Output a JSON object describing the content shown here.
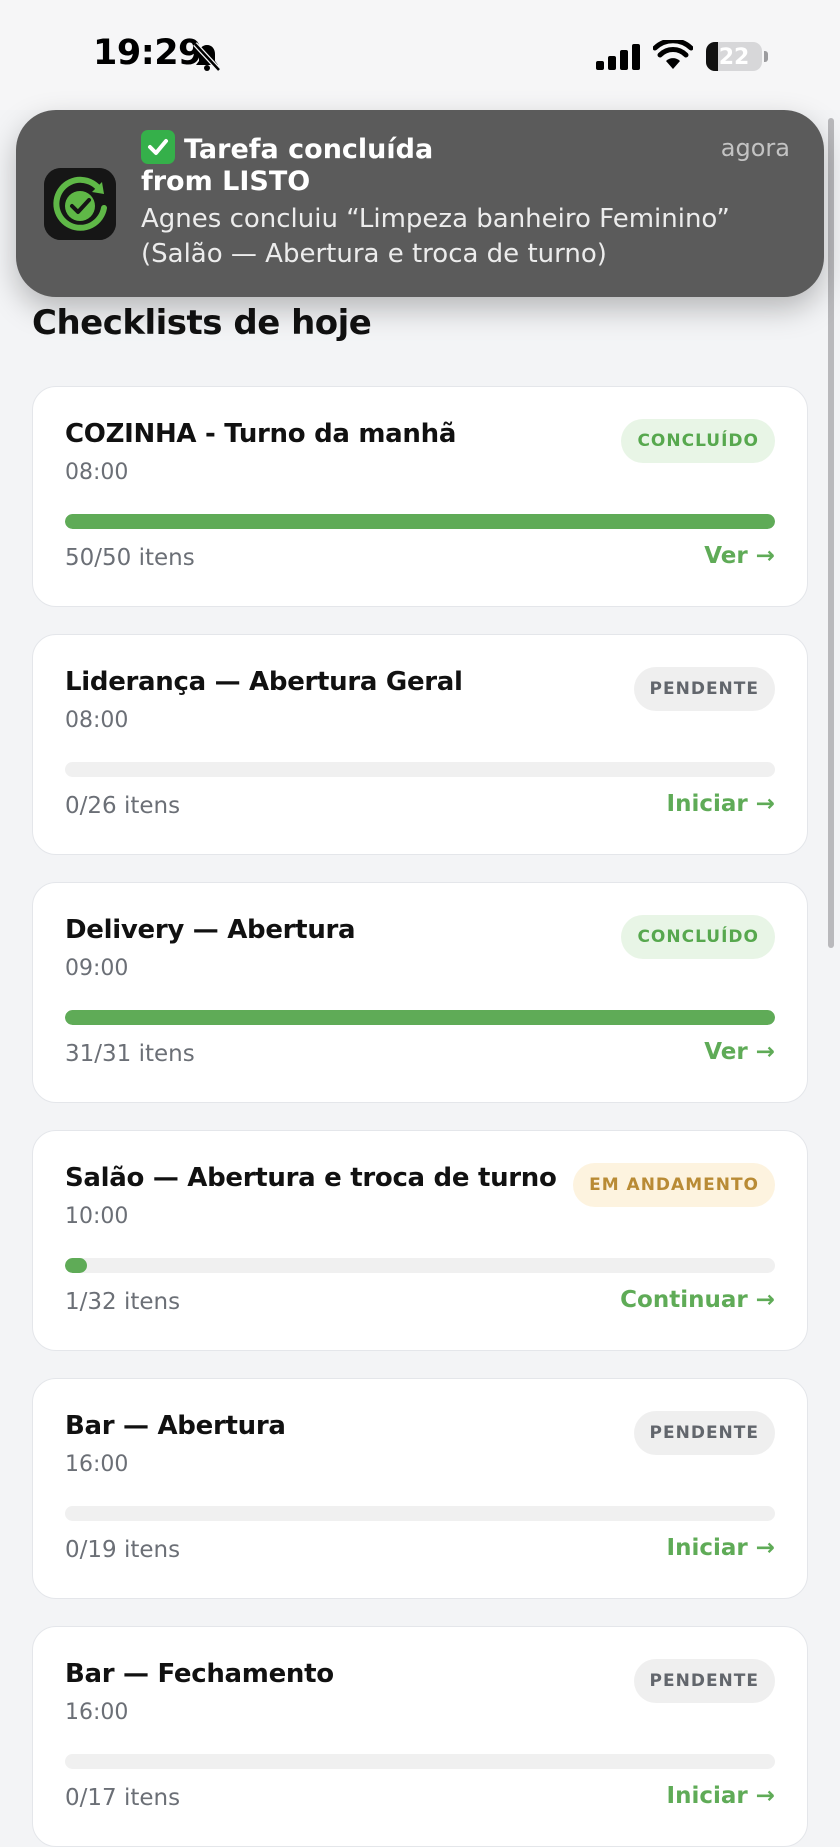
{
  "status_bar": {
    "time": "19:29",
    "battery_level": "22",
    "battery_fraction": 0.22
  },
  "notification": {
    "icon": "check-mark-button-icon",
    "title": "Tarefa concluída",
    "time": "agora",
    "from": "from LISTO",
    "body_line1": "Agnes concluiu “Limpeza banheiro Feminino”",
    "body_line2": "(Salão — Abertura e troca de turno)"
  },
  "page": {
    "title": "Checklists de hoje"
  },
  "colors": {
    "accent_green": "#5fab57",
    "done_badge_bg": "#e8f5e6",
    "progress_badge_bg": "#fdf3df",
    "progress_badge_text": "#b98b35"
  },
  "checklists": [
    {
      "title": "COZINHA - Turno da manhã",
      "time": "08:00",
      "status": "CONCLUÍDO",
      "status_type": "done",
      "progress": 1.0,
      "count": "50/50 itens",
      "action": "Ver →"
    },
    {
      "title": "Liderança — Abertura Geral",
      "time": "08:00",
      "status": "PENDENTE",
      "status_type": "pending",
      "progress": 0.0,
      "count": "0/26 itens",
      "action": "Iniciar →"
    },
    {
      "title": "Delivery — Abertura",
      "time": "09:00",
      "status": "CONCLUÍDO",
      "status_type": "done",
      "progress": 1.0,
      "count": "31/31 itens",
      "action": "Ver →"
    },
    {
      "title": "Salão — Abertura e troca de turno",
      "time": "10:00",
      "status": "EM ANDAMENTO",
      "status_type": "progress",
      "progress": 0.03125,
      "count": "1/32 itens",
      "action": "Continuar →"
    },
    {
      "title": "Bar — Abertura",
      "time": "16:00",
      "status": "PENDENTE",
      "status_type": "pending",
      "progress": 0.0,
      "count": "0/19 itens",
      "action": "Iniciar →"
    },
    {
      "title": "Bar — Fechamento",
      "time": "16:00",
      "status": "PENDENTE",
      "status_type": "pending",
      "progress": 0.0,
      "count": "0/17 itens",
      "action": "Iniciar →"
    }
  ]
}
